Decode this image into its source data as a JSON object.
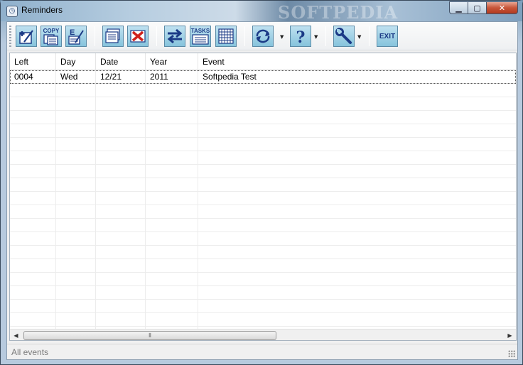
{
  "window": {
    "title": "Reminders",
    "watermark": "SOFTPEDIA"
  },
  "toolbar": {
    "copy_label": "COPY",
    "edit_label": "E",
    "tasks_label": "TASKS",
    "help_label": "?",
    "exit_label": "EXIT"
  },
  "table": {
    "columns": [
      "Left",
      "Day",
      "Date",
      "Year",
      "Event"
    ],
    "rows": [
      {
        "left": "0004",
        "day": "Wed",
        "date": "12/21",
        "year": "2011",
        "event": "Softpedia Test"
      }
    ]
  },
  "status": {
    "text": "All events"
  },
  "colors": {
    "toolbar_button": "#9fd0e6",
    "icon_dark": "#1b3a86",
    "delete_red": "#d0201c"
  }
}
